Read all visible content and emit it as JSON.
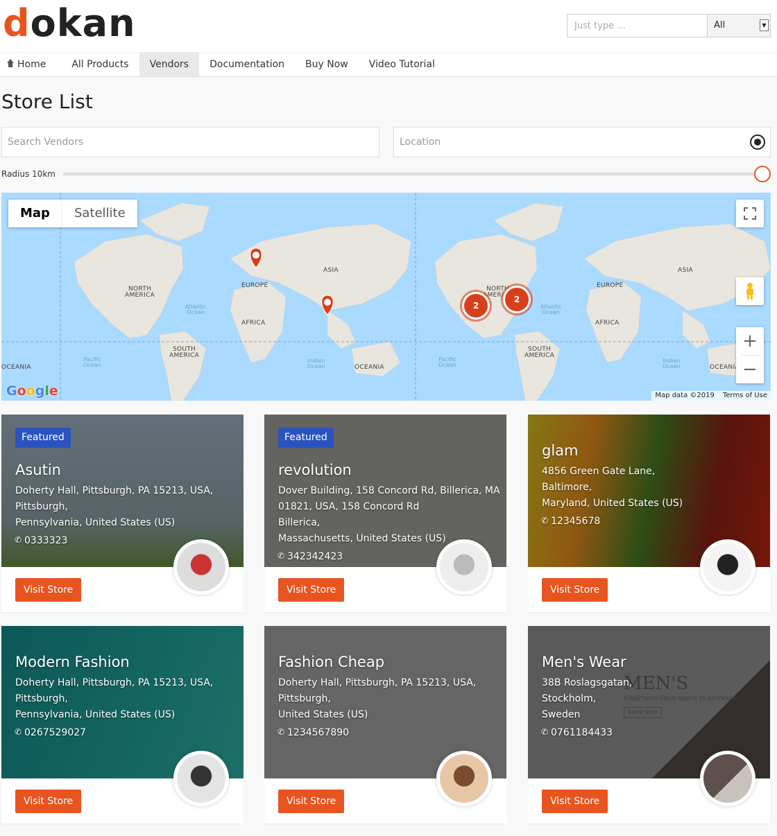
{
  "header": {
    "logo_d": "d",
    "logo_rest": "okan",
    "search_placeholder": "Just type ...",
    "search_scope": "All"
  },
  "nav": {
    "items": [
      "Home",
      "All Products",
      "Vendors",
      "Documentation",
      "Buy Now",
      "Video Tutorial"
    ],
    "active": "Vendors"
  },
  "page": {
    "title": "Store List",
    "search_placeholder": "Search Vendors",
    "location_placeholder": "Location",
    "radius_label": "Radius 10km",
    "radius_fraction": 1.0
  },
  "map": {
    "type_map": "Map",
    "type_satellite": "Satellite",
    "google": "Google",
    "attribution": "Map data ©2019",
    "terms": "Terms of Use",
    "zoom_in": "+",
    "zoom_out": "−",
    "continents": [
      "NORTH AMERICA",
      "SOUTH AMERICA",
      "EUROPE",
      "AFRICA",
      "ASIA",
      "OCEANIA"
    ],
    "oceans": [
      "Atlantic Ocean",
      "Pacific Ocean",
      "Indian Ocean"
    ],
    "clusters": [
      "2",
      "2"
    ]
  },
  "featured_label": "Featured",
  "visit_label": "Visit Store",
  "stores": [
    {
      "name": "Asutin",
      "featured": true,
      "address": [
        "Doherty Hall, Pittsburgh, PA 15213, USA,",
        "Pittsburgh,",
        "Pennsylvania, United States (US)"
      ],
      "phone": "0333323",
      "color": "#7d8d8b"
    },
    {
      "name": "revolution",
      "featured": true,
      "address": [
        "Dover Building, 158 Concord Rd, Billerica, MA",
        "01821, USA, 158 Concord Rd",
        "Billerica,",
        "Massachusetts, United States (US)"
      ],
      "phone": "342342423",
      "color": "#8a8a86"
    },
    {
      "name": "glam",
      "featured": false,
      "address": [
        "4856 Green Gate Lane,",
        "Baltimore,",
        "Maryland, United States (US)"
      ],
      "phone": "12345678",
      "color": "#6b4a1c"
    },
    {
      "name": "Modern Fashion",
      "featured": false,
      "address": [
        "Doherty Hall, Pittsburgh, PA 15213, USA,",
        "Pittsburgh,",
        "Pennsylvania, United States (US)"
      ],
      "phone": "0267529027",
      "color": "#1f8a85"
    },
    {
      "name": "Fashion Cheap",
      "featured": false,
      "address": [
        "Doherty Hall, Pittsburgh, PA 15213, USA,",
        "Pittsburgh,",
        "United States (US)"
      ],
      "phone": "1234567890",
      "color": "#8c8c8c"
    },
    {
      "name": "Men's Wear",
      "featured": false,
      "address": [
        "38B Roslagsgatan,",
        "Stockholm,",
        "Sweden"
      ],
      "phone": "0761184433",
      "color": "#7a7a7a"
    }
  ],
  "banner_text": {
    "mens_title": "MEN'S",
    "mens_sub": "EVERYTHING FROM SHIRTS TO KNITWEAR",
    "mens_btn": "SHOP NOW"
  }
}
